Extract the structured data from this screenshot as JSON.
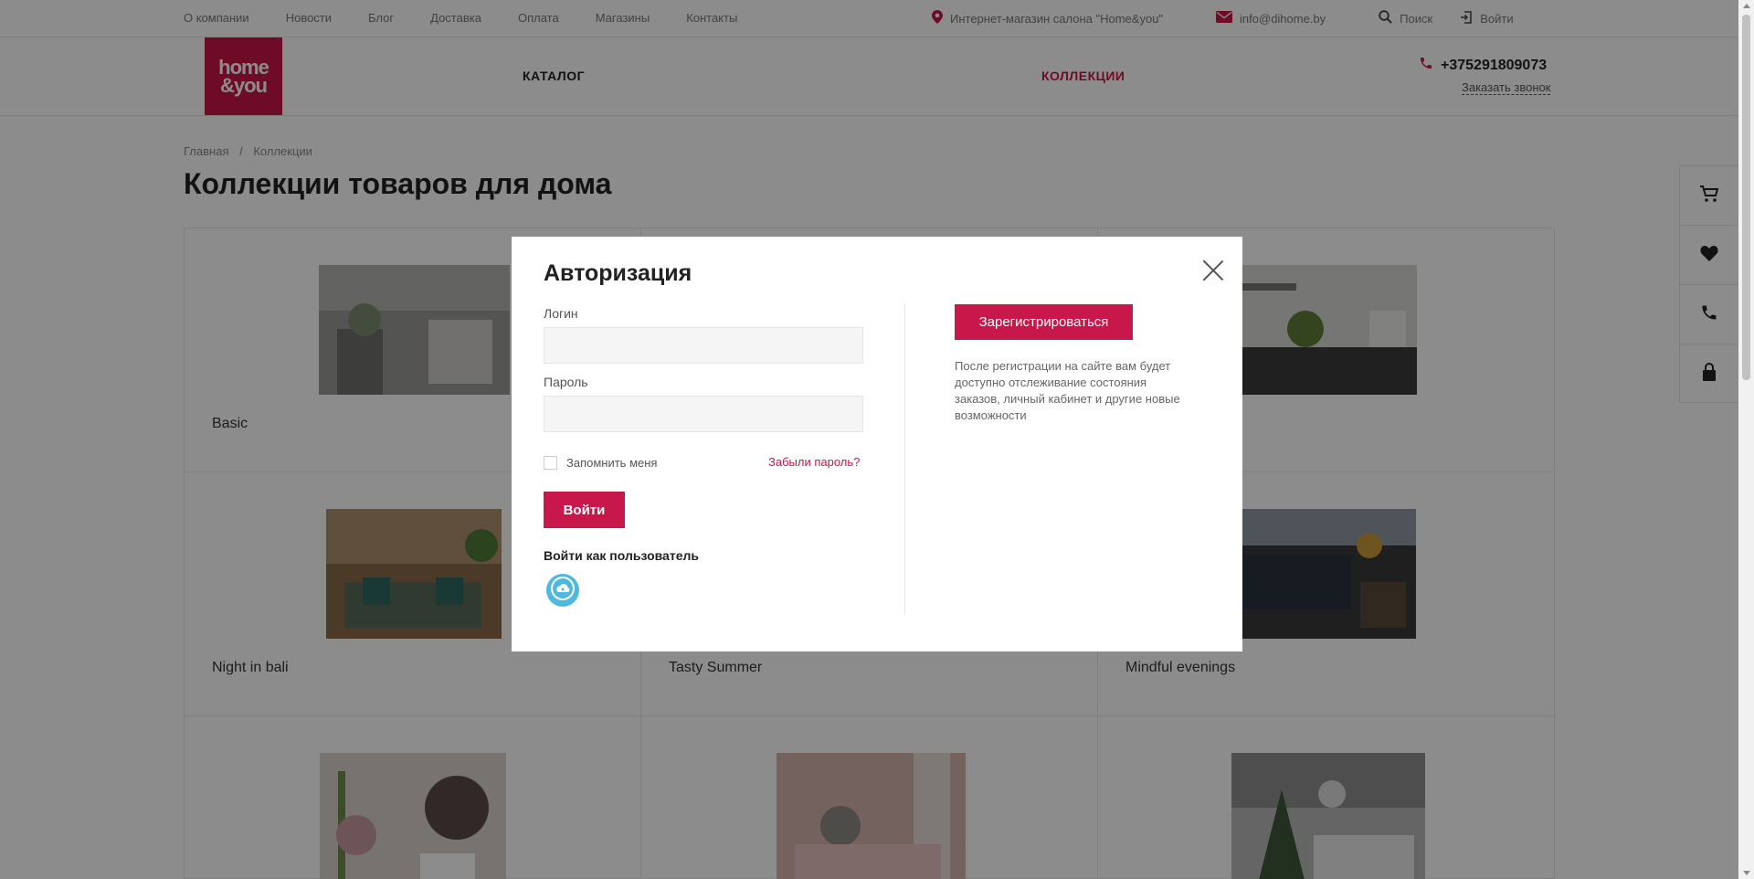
{
  "topbar": {
    "nav": [
      "О компании",
      "Новости",
      "Блог",
      "Доставка",
      "Оплата",
      "Магазины",
      "Контакты"
    ],
    "shop_label": "Интернет-магазин салона \"Home&you\"",
    "email": "info@dihome.by",
    "search_label": "Поиск",
    "login_label": "Войти"
  },
  "header": {
    "logo_line1": "home",
    "logo_line2": "&you",
    "catalog": "КАТАЛОГ",
    "collections": "КОЛЛЕКЦИИ",
    "phone": "+375291809073",
    "callback": "Заказать звонок"
  },
  "breadcrumb": {
    "home": "Главная",
    "separator": "/",
    "current": "Коллекции"
  },
  "page_title": "Коллекции товаров для дома",
  "collections": [
    {
      "name": "Basic"
    },
    {
      "name": ""
    },
    {
      "name": ""
    },
    {
      "name": "Night in bali"
    },
    {
      "name": "Tasty Summer"
    },
    {
      "name": "Mindful evenings"
    },
    {
      "name": ""
    },
    {
      "name": ""
    },
    {
      "name": ""
    }
  ],
  "modal": {
    "title": "Авторизация",
    "login_label": "Логин",
    "login_value": "",
    "password_label": "Пароль",
    "password_value": "",
    "remember": "Запомнить меня",
    "forgot": "Забыли пароль?",
    "submit": "Войти",
    "login_as": "Войти как пользователь",
    "register": "Зарегистрироваться",
    "register_note": "После регистрации на сайте вам будет доступно отслеживание состояния заказов, личный кабинет и другие новые возможности"
  },
  "colors": {
    "accent": "#c8174a",
    "social": "#4fb8de"
  }
}
